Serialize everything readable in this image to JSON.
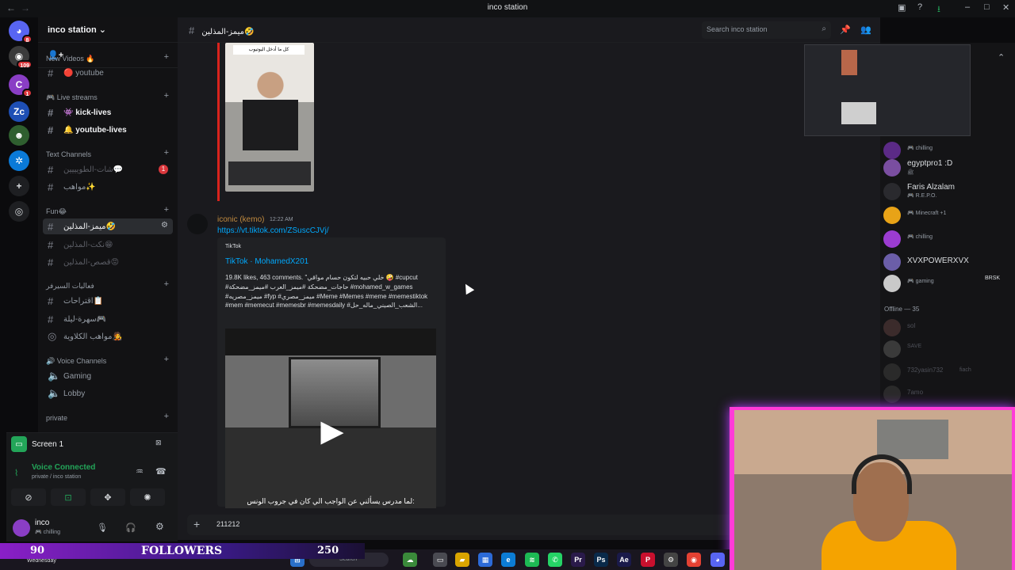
{
  "window": {
    "title": "inco station"
  },
  "server": {
    "name": "inco station"
  },
  "sidebar": {
    "categories": [
      {
        "label": "New Videos 🔥"
      },
      {
        "label": "🎮 Live streams"
      },
      {
        "label": "Text Channels"
      },
      {
        "label": "Fun😂"
      },
      {
        "label": "فعاليات السيرفر"
      },
      {
        "label": "🔊 Voice Channels"
      },
      {
        "label": "private"
      }
    ],
    "channels": [
      {
        "label": "🔴 youtube"
      },
      {
        "label": "👾 kick-lives"
      },
      {
        "label": "🔔 youtube-lives"
      },
      {
        "label": "شات-الطويييين💬",
        "unread": "1"
      },
      {
        "label": "مواهب✨"
      },
      {
        "label": "ميمز-المذلين🤣"
      },
      {
        "label": "نكت-المذلين😁"
      },
      {
        "label": "قصص-المذلين😡"
      },
      {
        "label": "اقتراحات📋"
      },
      {
        "label": "سهرة-ليلة🎮"
      },
      {
        "label": "مواهب الكلاوية🧑‍🎤"
      },
      {
        "label": "Gaming"
      },
      {
        "label": "Lobby"
      }
    ]
  },
  "voice_panel": {
    "screen_label": "Screen 1",
    "status": "Voice Connected",
    "location": "private / inco station"
  },
  "user": {
    "name": "inco",
    "status": "🎮 chilling"
  },
  "channel_header": {
    "name": "ميمز-المذلين🤣"
  },
  "search": {
    "placeholder": "Search inco station"
  },
  "messages": {
    "thumb_caption": "كل ما أدخل اليوتيوب",
    "author": "iconic (kemo)",
    "time": "12:22 AM",
    "link": "https://vt.tiktok.com/ZSuscCJVj/",
    "embed": {
      "provider": "TikTok",
      "title": "TikTok · MohamedX201",
      "description": "19.8K likes, 463 comments. \"خلي حبيه لتكون حسام مواقي 🤪 #cupcut #حاجات_مضحكة #ميمز_العرب #ميمز_مضحكة #mohamed_w_games #ميمز_مصريه #fyp #ميمز_مصري #Meme #Memes #meme #memestiktok #mem #memecut #memesbr #memesdaily #الشعب_الصيني_ماله_حل...",
      "video_subtitle": "لما مدرس يسألني عن الواجب الي كان في جروب الونس:"
    }
  },
  "composer": {
    "text": "211212"
  },
  "members": {
    "online": [
      {
        "name": "",
        "activity": "🎮 chilling"
      },
      {
        "name": "egyptpro1 :D",
        "activity": "ﷺ"
      },
      {
        "name": "Faris Alzalam",
        "activity": "🎮 R.E.P.O."
      },
      {
        "name": "",
        "activity": "🎮 Minecraft +1"
      },
      {
        "name": "",
        "activity": "🎮 chilling"
      },
      {
        "name": "XVXPOWERXVX",
        "activity": ""
      },
      {
        "name": "",
        "activity": "🎮 gaming"
      }
    ],
    "brsk_tag": "BRSK",
    "offline_header": "Offline — 35",
    "offline": [
      {
        "name": "sol",
        "activity": ""
      },
      {
        "name": "SAVE",
        "activity": ""
      },
      {
        "name": "732yasin732",
        "activity": "fiach"
      },
      {
        "name": "7amo",
        "activity": ""
      }
    ]
  },
  "stream_overlay": {
    "count_left": "90",
    "label": "FOLLOWERS",
    "count_right": "250"
  },
  "taskbar": {
    "day": "Wednesday",
    "search_placeholder": "Search"
  },
  "colors": {
    "accent": "#00a8fc",
    "overlay": "#ff3bd8",
    "brand": "#5865f2"
  }
}
